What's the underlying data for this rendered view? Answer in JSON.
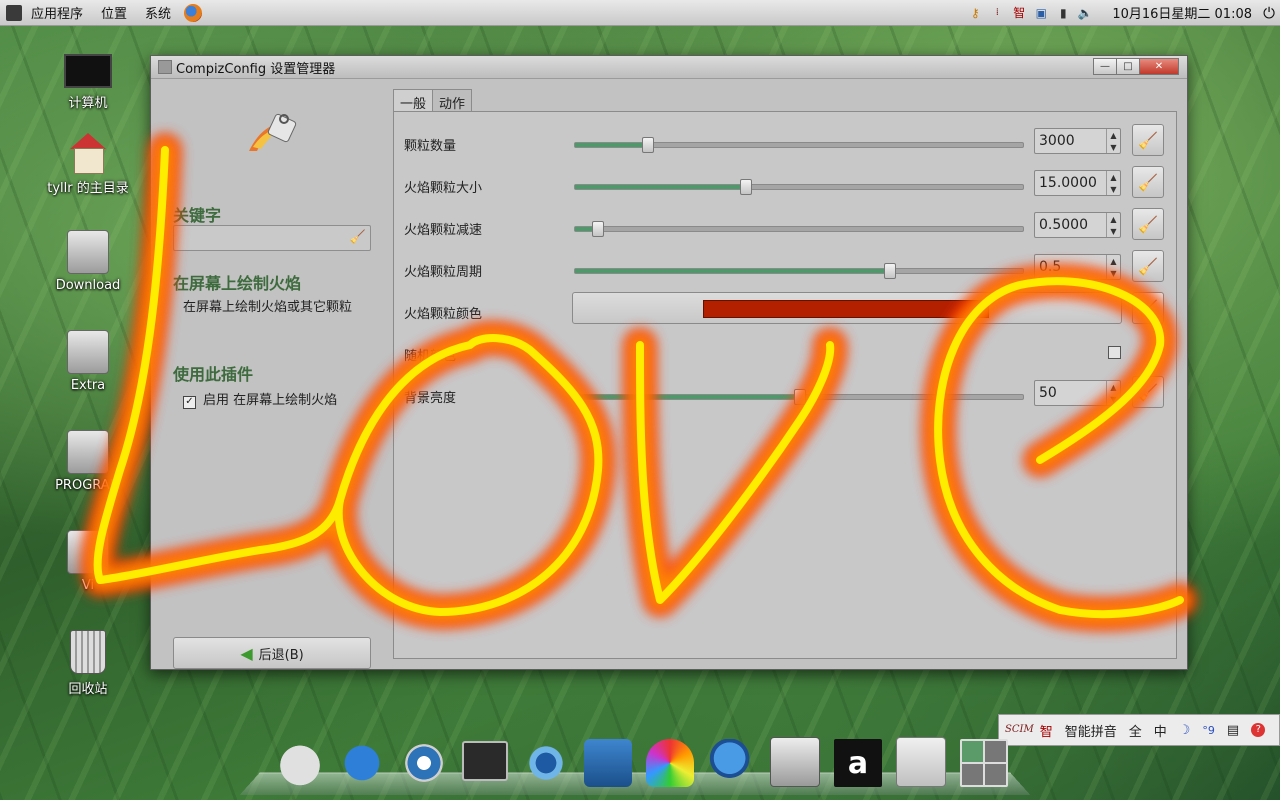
{
  "top_panel": {
    "menus": [
      "应用程序",
      "位置",
      "系统"
    ],
    "clock": "10月16日星期二 01:08",
    "tray_icons": [
      "keys-icon",
      "ime-sc-icon",
      "ime-zhi-icon",
      "network-icon",
      "battery-icon",
      "volume-icon",
      "power-icon"
    ],
    "tray_glyphs": {
      "ime_zhi": "智"
    }
  },
  "desktop": {
    "icons": [
      {
        "name": "computer",
        "label": "计算机"
      },
      {
        "name": "home",
        "label": "tyllr 的主目录"
      },
      {
        "name": "download",
        "label": "Download"
      },
      {
        "name": "extra",
        "label": "Extra"
      },
      {
        "name": "program",
        "label": "PROGRAM"
      },
      {
        "name": "vista",
        "label": "Vi"
      },
      {
        "name": "trash",
        "label": "回收站"
      }
    ]
  },
  "window": {
    "title": "CompizConfig 设置管理器",
    "left": {
      "search_heading": "关键字",
      "plugin_heading": "在屏幕上绘制火焰",
      "plugin_description": "在屏幕上绘制火焰或其它颗粒",
      "enable_heading": "使用此插件",
      "enable_label": "启用 在屏幕上绘制火焰",
      "enable_checked": true,
      "back_label": "后退(B)"
    },
    "tabs": [
      {
        "label": "一般",
        "active": true
      },
      {
        "label": "动作",
        "active": false
      }
    ],
    "settings": [
      {
        "label": "颗粒数量",
        "value": "3000",
        "slider": 0.16
      },
      {
        "label": "火焰颗粒大小",
        "value": "15.0000",
        "slider": 0.38
      },
      {
        "label": "火焰颗粒减速",
        "value": "0.5000",
        "slider": 0.05
      },
      {
        "label": "火焰颗粒周期",
        "value": "0.5",
        "slider": 0.7
      },
      {
        "label": "火焰颗粒颜色",
        "color": "#b32000"
      },
      {
        "label": "随机颜色",
        "checked": false
      },
      {
        "label": "背景亮度",
        "value": "50",
        "slider": 0.5
      }
    ]
  },
  "ime_bar": {
    "logo": "SCIM",
    "zhi": "智",
    "engine": "智能拼音",
    "full": "全",
    "lang": "中",
    "punct": "°9"
  },
  "dock": {
    "items": [
      "apple-icon",
      "ie-icon",
      "term-icon",
      "console-icon",
      "network-manager-icon",
      "globe-icon",
      "photo-icon",
      "firefox-icon",
      "drive-icon",
      "a-icon",
      "settings-icon",
      "workspace-icon"
    ],
    "a_glyph": "a"
  },
  "colors": {
    "accent": "#3e6b3e",
    "fire_core": "#fff200",
    "fire_edge": "#ff3a00"
  }
}
